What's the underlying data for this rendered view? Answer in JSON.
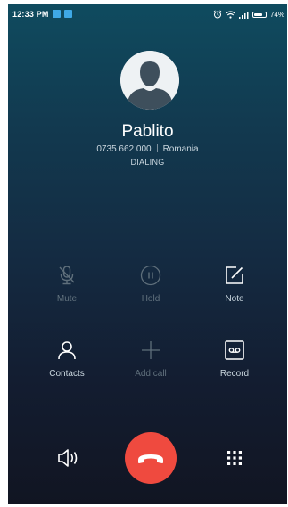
{
  "status_bar": {
    "time": "12:33 PM",
    "battery_text": "74%",
    "battery_level": 0.74,
    "icons": [
      "notification-icon",
      "notification-icon",
      "alarm-icon",
      "wifi-icon",
      "signal-icon",
      "battery-icon"
    ]
  },
  "caller": {
    "name": "Pablito",
    "number": "0735 662 000",
    "location": "Romania",
    "status": "DIALING",
    "avatar_icon": "person-silhouette-icon"
  },
  "controls": [
    {
      "label": "Mute",
      "icon": "mute-microphone-icon",
      "enabled": false
    },
    {
      "label": "Hold",
      "icon": "pause-icon",
      "enabled": false
    },
    {
      "label": "Note",
      "icon": "note-edit-icon",
      "enabled": true
    },
    {
      "label": "Contacts",
      "icon": "person-icon",
      "enabled": true
    },
    {
      "label": "Add call",
      "icon": "plus-icon",
      "enabled": false
    },
    {
      "label": "Record",
      "icon": "record-tape-icon",
      "enabled": true
    }
  ],
  "bottom_bar": {
    "speaker_icon": "speaker-icon",
    "end_call_icon": "end-call-icon",
    "end_call_color": "#ef4a3f",
    "dialpad_icon": "dialpad-icon"
  },
  "colors": {
    "background_top": "#0f4b5f",
    "background_bottom": "#111522",
    "accent_blue": "#3fa9e6",
    "disabled_text": "#61717d"
  }
}
